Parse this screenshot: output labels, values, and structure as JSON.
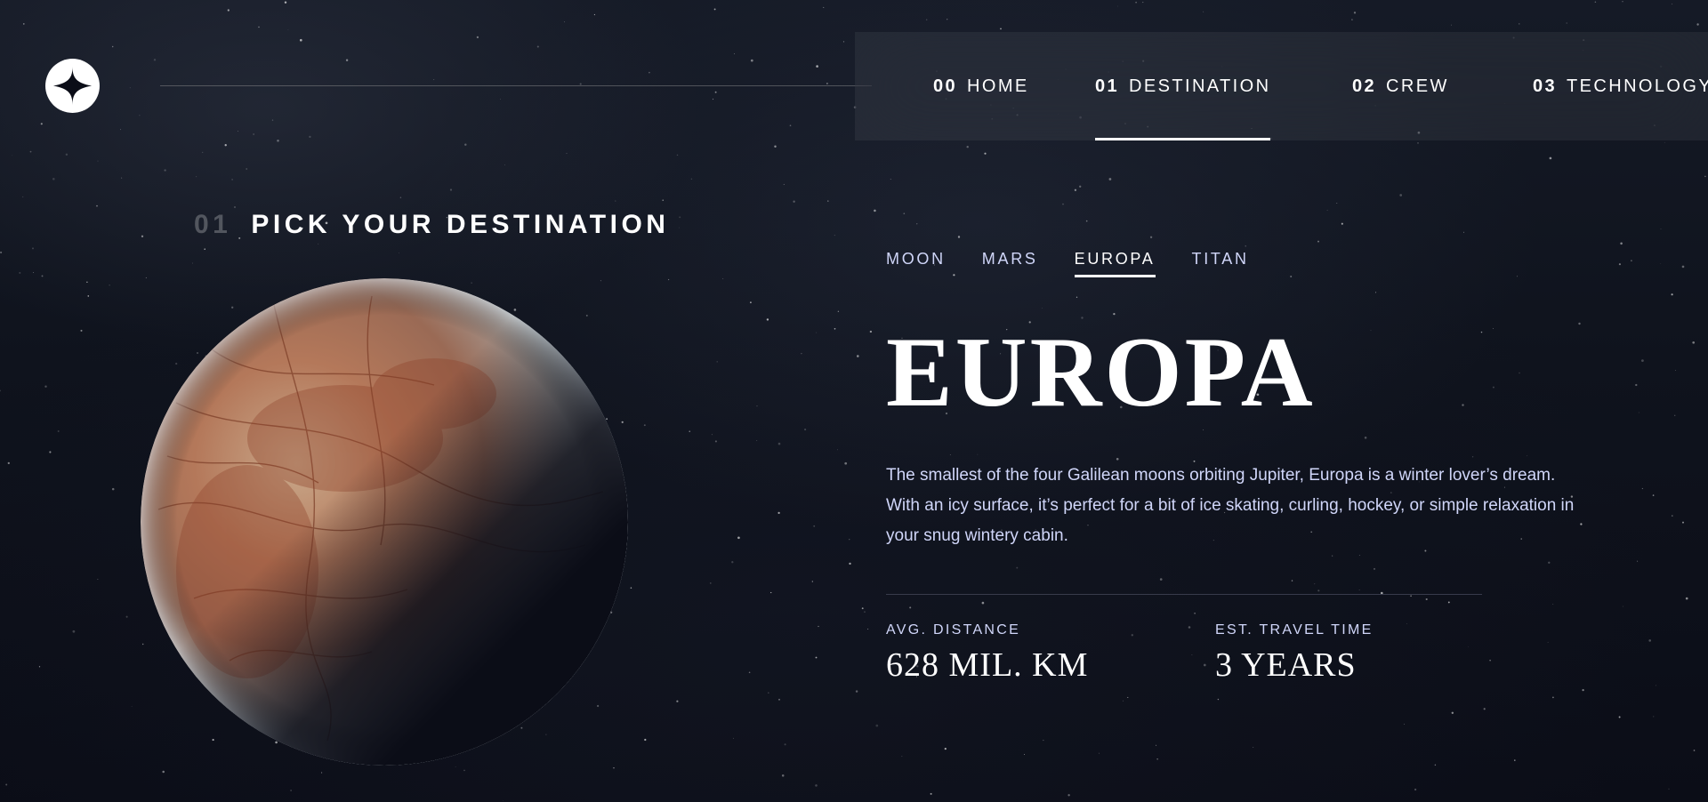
{
  "nav": {
    "items": [
      {
        "num": "00",
        "label": "HOME"
      },
      {
        "num": "01",
        "label": "DESTINATION"
      },
      {
        "num": "02",
        "label": "CREW"
      },
      {
        "num": "03",
        "label": "TECHNOLOGY"
      }
    ],
    "active_index": 1
  },
  "page": {
    "heading_num": "01",
    "heading_text": "PICK YOUR DESTINATION"
  },
  "tabs": {
    "items": [
      "MOON",
      "MARS",
      "EUROPA",
      "TITAN"
    ],
    "active_index": 2
  },
  "destination": {
    "name": "EUROPA",
    "description": "The smallest of the four Galilean moons orbiting Jupiter, Europa is a winter lover’s dream. With an icy surface, it’s perfect for a bit of ice skating, curling, hockey, or simple relaxation in your snug wintery cabin.",
    "distance_label": "AVG. DISTANCE",
    "distance_value": "628 MIL. KM",
    "travel_label": "EST. TRAVEL TIME",
    "travel_value": "3 YEARS"
  },
  "icons": {
    "logo": "four-point-star-logo-icon",
    "planet": "europa-moon-image"
  },
  "colors": {
    "background": "#0b0d17",
    "text_light": "#d0d6f9",
    "white": "#ffffff"
  }
}
